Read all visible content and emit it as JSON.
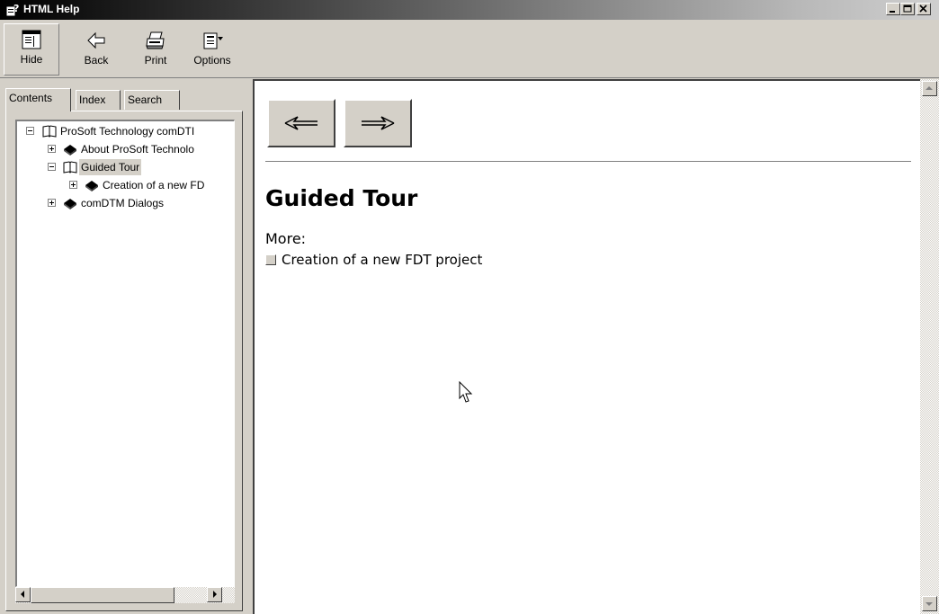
{
  "window": {
    "title": "HTML Help"
  },
  "toolbar": {
    "hide_label": "Hide",
    "back_label": "Back",
    "print_label": "Print",
    "options_label": "Options"
  },
  "tabs": [
    {
      "label": "Contents",
      "active": true
    },
    {
      "label": "Index",
      "active": false
    },
    {
      "label": "Search",
      "active": false
    }
  ],
  "tree": [
    {
      "label": "ProSoft Technology comDTI",
      "expanded": true,
      "icon": "open-book-icon"
    },
    {
      "label": "About ProSoft Technolo",
      "expanded": false,
      "icon": "closed-book-icon"
    },
    {
      "label": "Guided Tour",
      "expanded": true,
      "icon": "open-book-icon",
      "selected": true
    },
    {
      "label": "Creation of a new FD",
      "expanded": false,
      "icon": "closed-book-icon"
    },
    {
      "label": "comDTM Dialogs",
      "expanded": false,
      "icon": "closed-book-icon"
    }
  ],
  "page": {
    "heading": "Guided Tour",
    "more_label": "More:",
    "links": [
      "Creation of a new FDT project"
    ]
  },
  "colors": {
    "face": "#d4d0c8",
    "shadow": "#404040",
    "highlight": "#ffffff",
    "content_bg": "#ffffff"
  }
}
